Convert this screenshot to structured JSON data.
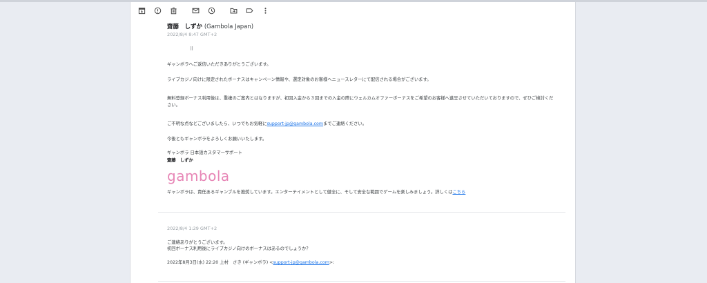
{
  "toolbar": {
    "icons": [
      "archive-icon",
      "report-icon",
      "delete-icon",
      "mark-unread-icon",
      "snooze-icon",
      "move-to-icon",
      "label-icon",
      "more-icon"
    ]
  },
  "message1": {
    "sender_name": "齋藤　しずか",
    "sender_org": "(Gambola Japan)",
    "date": "2022/8/4 8:47 GMT+2",
    "ellipsis": "⠿",
    "p1": "ギャンボラへご返信いただきありがとうございます。",
    "p2": "ライブカジノ向けに限定されたボーナスはキャンペーン情報や、選定対象のお客様へニュースレターにて配信される場合がございます。",
    "p3": "無料登録ボーナス利用後は、重複のご案内とはなりますが、初回入金から３回までの入金の際にウェルカムオファーボーナスをご希望のお客様へ進呈させていただいておりますので、ぜひご検討くだ",
    "p3b": "さい。",
    "p4a": "ご不明な点などございましたら、いつでもお気軽に",
    "p4link": "support-jp@gambola.com",
    "p4b": "までご連絡ください。",
    "p5": "今後ともギャンボラをよろしくお願いいたします。",
    "sig_team": "ギャンボラ 日本語カスタマーサポート",
    "sig_name": "齋藤　しずか",
    "logo": "gambola",
    "footer_a": "ギャンボラは、責任あるギャンブルを推奨しています。エンターテイメントとして健全に、そして安全な範囲でゲームを楽しみましょう。詳しくは",
    "footer_link": "こちら"
  },
  "message2": {
    "date": "2022/8/4 1:29 GMT+2",
    "line1": "ご連絡ありがとうございます。",
    "line2": "初回ボーナス利用後にライブカジノ向けのボーナスはあるのでしょうか？",
    "quote_a": "2022年8月3日(水) 22:20 上村　さき (ギャンボラ) <",
    "quote_link": "support-jp@gambola.com",
    "quote_b": ">:"
  }
}
